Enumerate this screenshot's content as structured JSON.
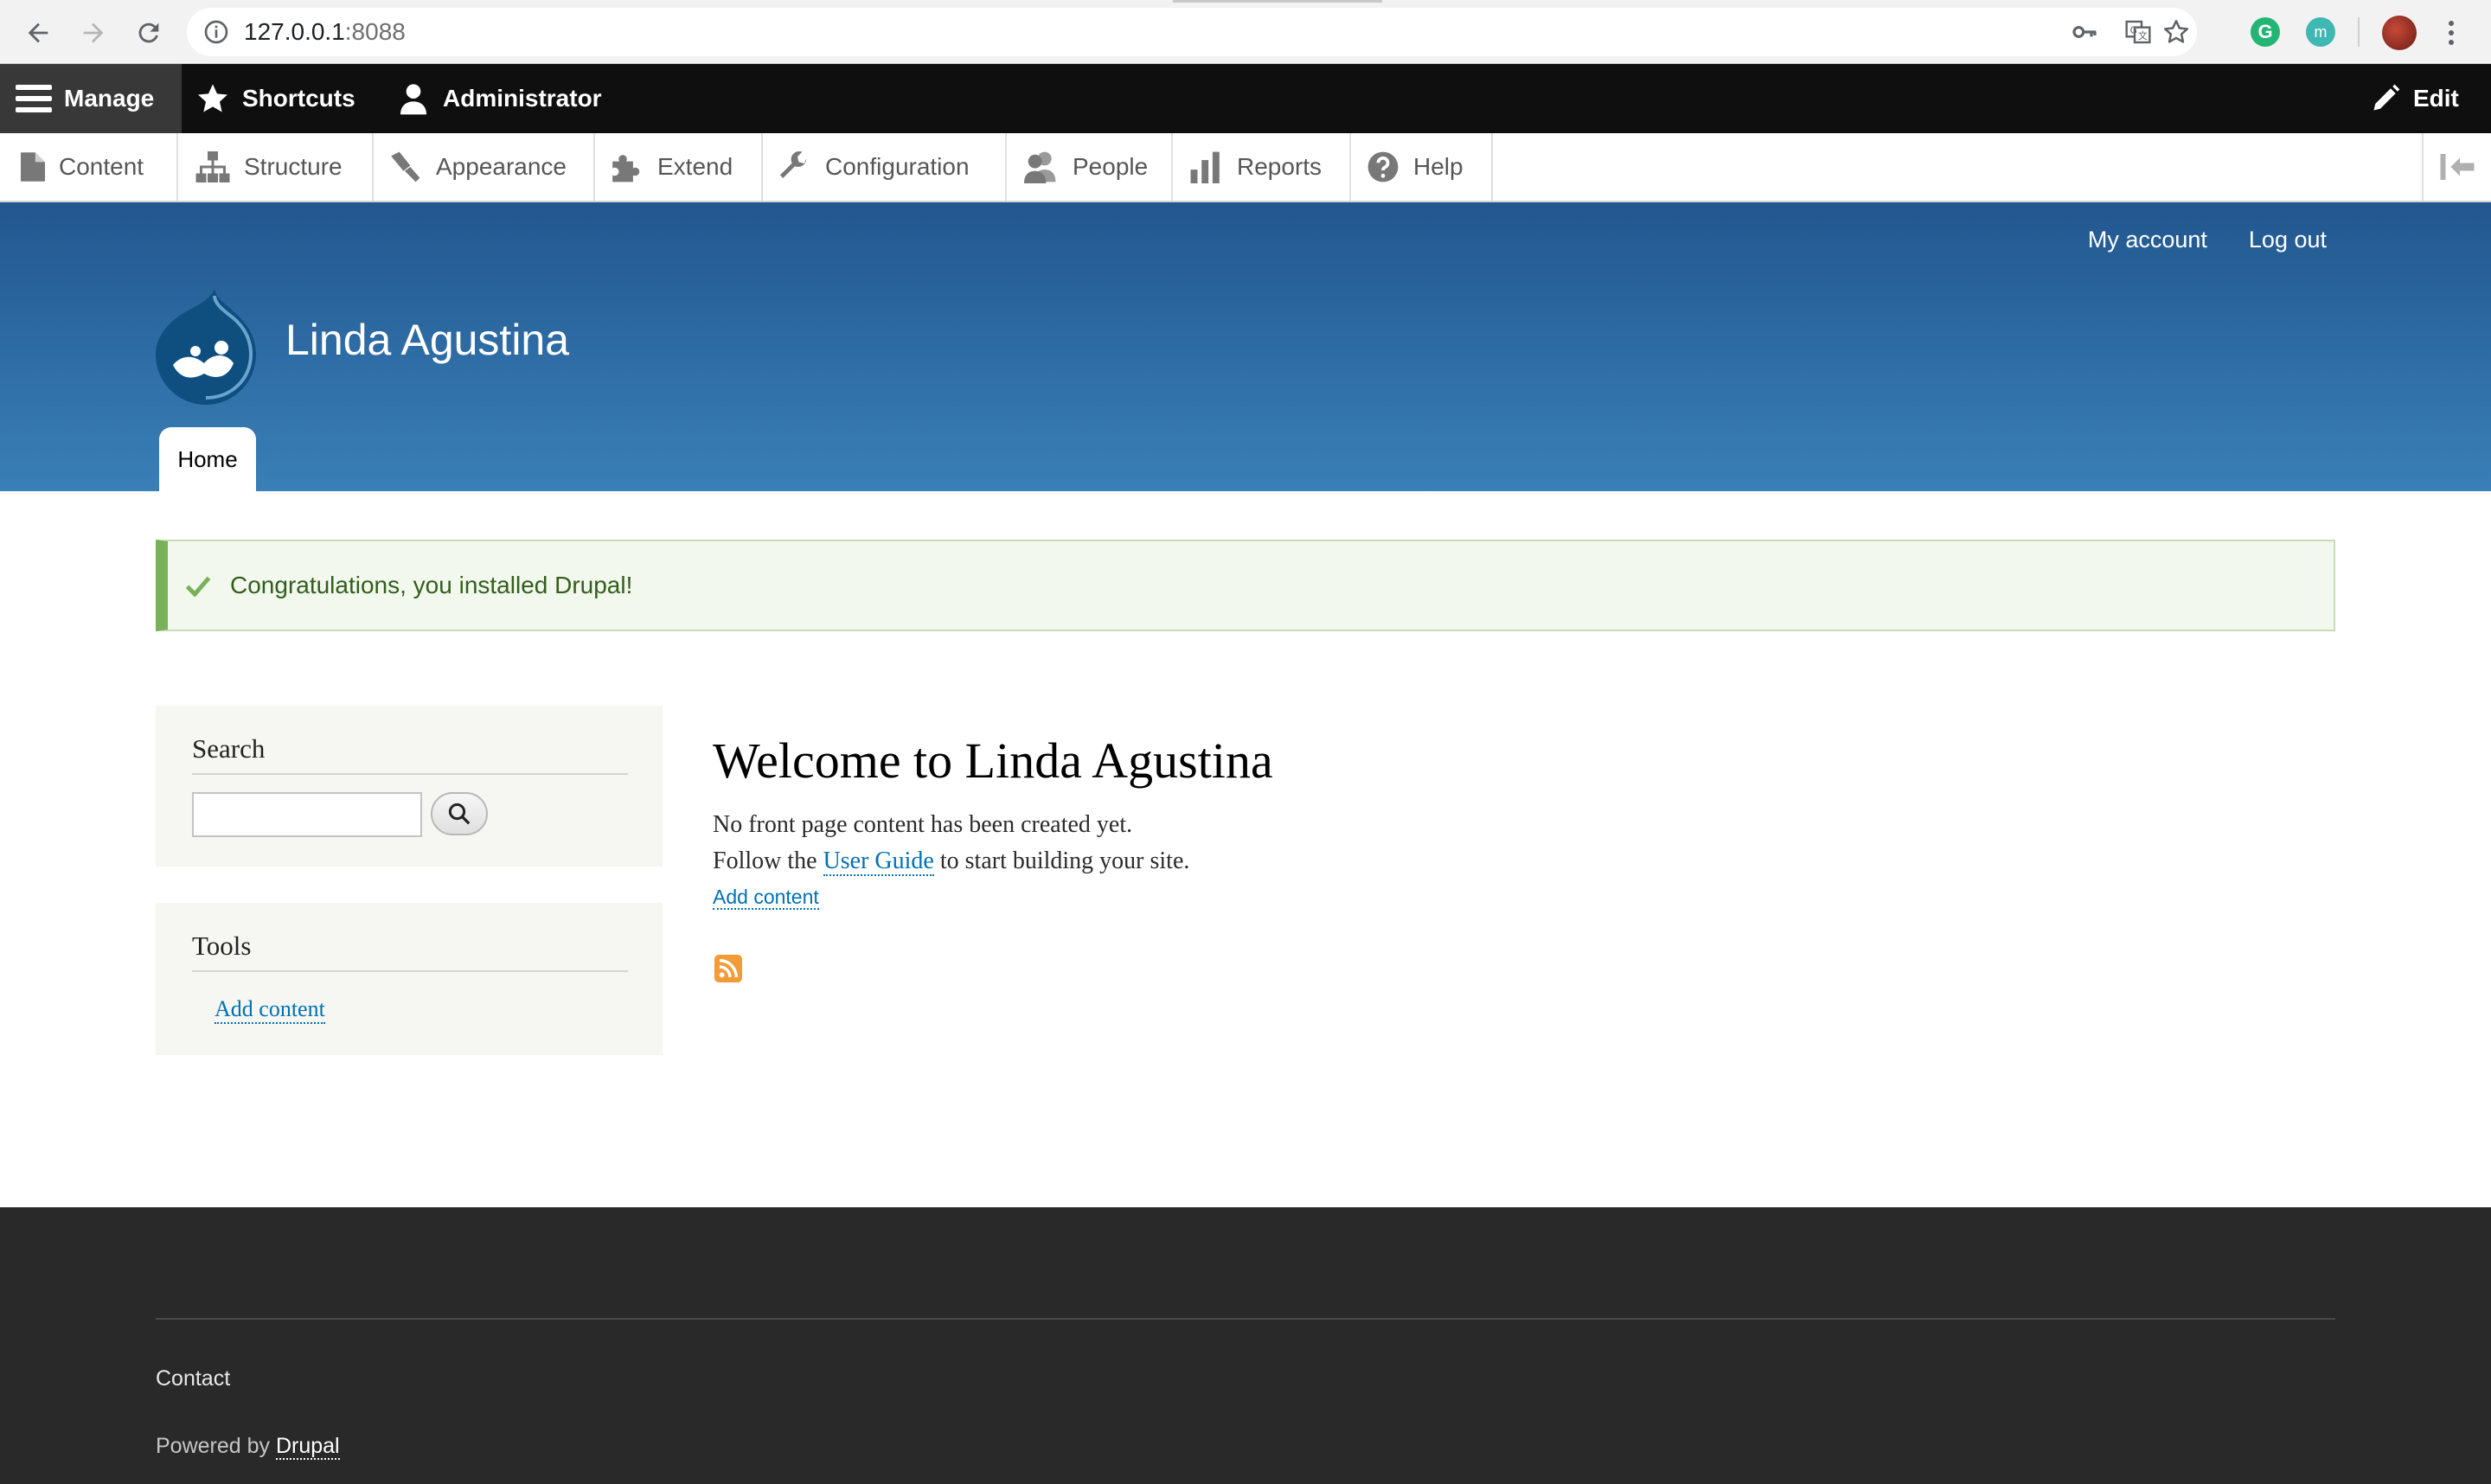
{
  "browser": {
    "url_host": "127.0.0.1",
    "url_port": ":8088",
    "extension_g_letter": "G",
    "extension_m_letter": "m"
  },
  "admin_toolbar": {
    "manage": "Manage",
    "shortcuts": "Shortcuts",
    "administrator": "Administrator",
    "edit": "Edit"
  },
  "admin_tray": {
    "items": [
      {
        "label": "Content",
        "icon": "file-icon"
      },
      {
        "label": "Structure",
        "icon": "sitemap-icon"
      },
      {
        "label": "Appearance",
        "icon": "paintbrush-icon"
      },
      {
        "label": "Extend",
        "icon": "puzzle-icon"
      },
      {
        "label": "Configuration",
        "icon": "wrench-icon"
      },
      {
        "label": "People",
        "icon": "people-icon"
      },
      {
        "label": "Reports",
        "icon": "bar-chart-icon"
      },
      {
        "label": "Help",
        "icon": "question-icon"
      }
    ]
  },
  "header": {
    "my_account": "My account",
    "log_out": "Log out",
    "site_name": "Linda Agustina",
    "home_tab": "Home"
  },
  "status": {
    "message": "Congratulations, you installed Drupal!"
  },
  "sidebar": {
    "search_title": "Search",
    "tools_title": "Tools",
    "tools_link": "Add content"
  },
  "main": {
    "title": "Welcome to Linda Agustina",
    "line1": "No front page content has been created yet.",
    "line2_before": "Follow the ",
    "line2_link": "User Guide",
    "line2_after": " to start building your site.",
    "add_content": "Add content"
  },
  "footer": {
    "contact": "Contact",
    "powered_by": "Powered by ",
    "powered_link": "Drupal"
  },
  "colors": {
    "toolbar_bg": "#0f0f0f",
    "header_top": "#22578f",
    "header_bottom": "#3a7fb8",
    "link": "#0071b3",
    "status_accent": "#77b259",
    "footer_bg": "#292929"
  }
}
